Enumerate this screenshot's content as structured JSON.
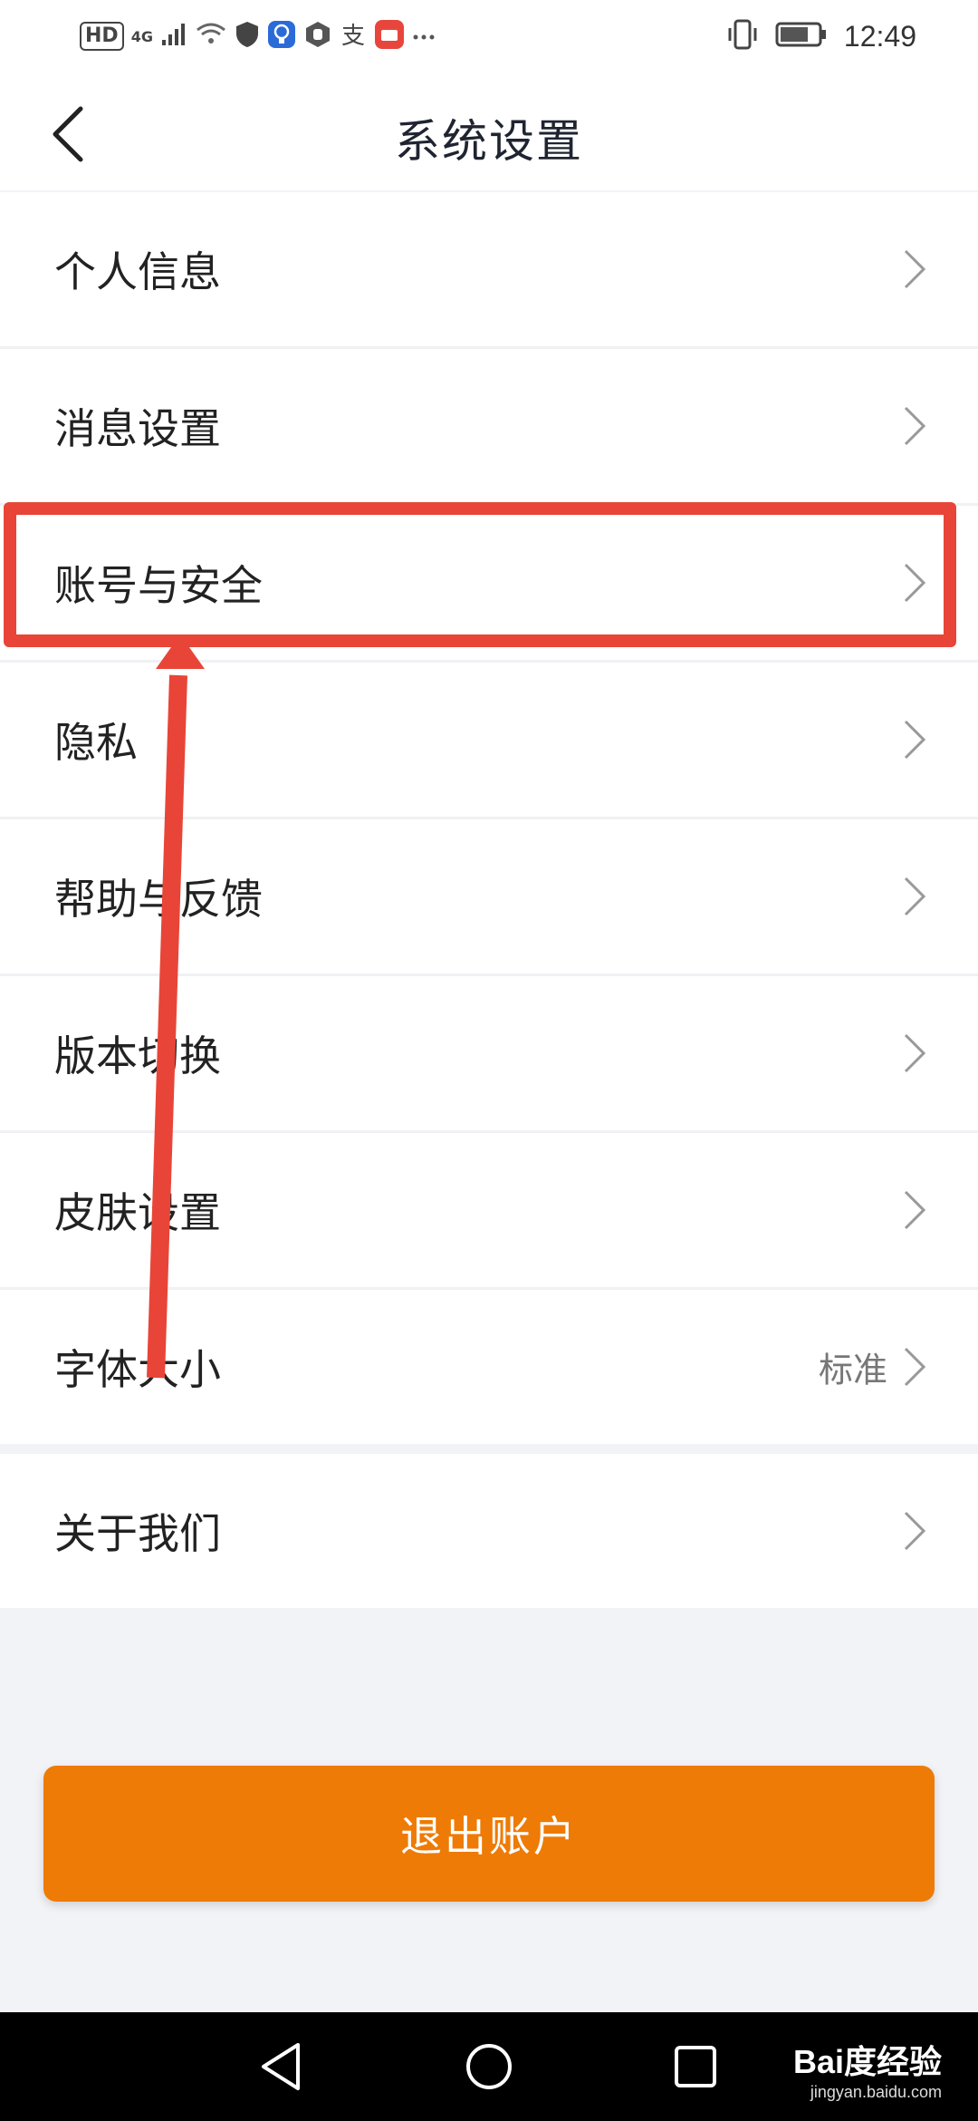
{
  "status_bar": {
    "hd": "HD",
    "network": "4G",
    "time": "12:49",
    "icons": [
      "signal-icon",
      "wifi-icon",
      "shield-icon",
      "bulb-icon",
      "hand-icon",
      "alipay-icon",
      "huawei-app-icon",
      "more-dots-icon",
      "vibrate-icon",
      "battery-icon"
    ]
  },
  "header": {
    "title": "系统设置"
  },
  "settings": {
    "items": [
      {
        "label": "个人信息"
      },
      {
        "label": "消息设置"
      },
      {
        "label": "账号与安全"
      },
      {
        "label": "隐私"
      },
      {
        "label": "帮助与反馈"
      },
      {
        "label": "版本切换"
      },
      {
        "label": "皮肤设置"
      },
      {
        "label": "字体大小",
        "value": "标准"
      }
    ],
    "about": {
      "label": "关于我们"
    }
  },
  "logout": {
    "label": "退出账户"
  },
  "watermark": {
    "brand": "Bai度经验",
    "url": "jingyan.baidu.com"
  },
  "colors": {
    "accent": "#ee7b05",
    "annotation": "#e84538",
    "background": "#f2f3f7"
  }
}
